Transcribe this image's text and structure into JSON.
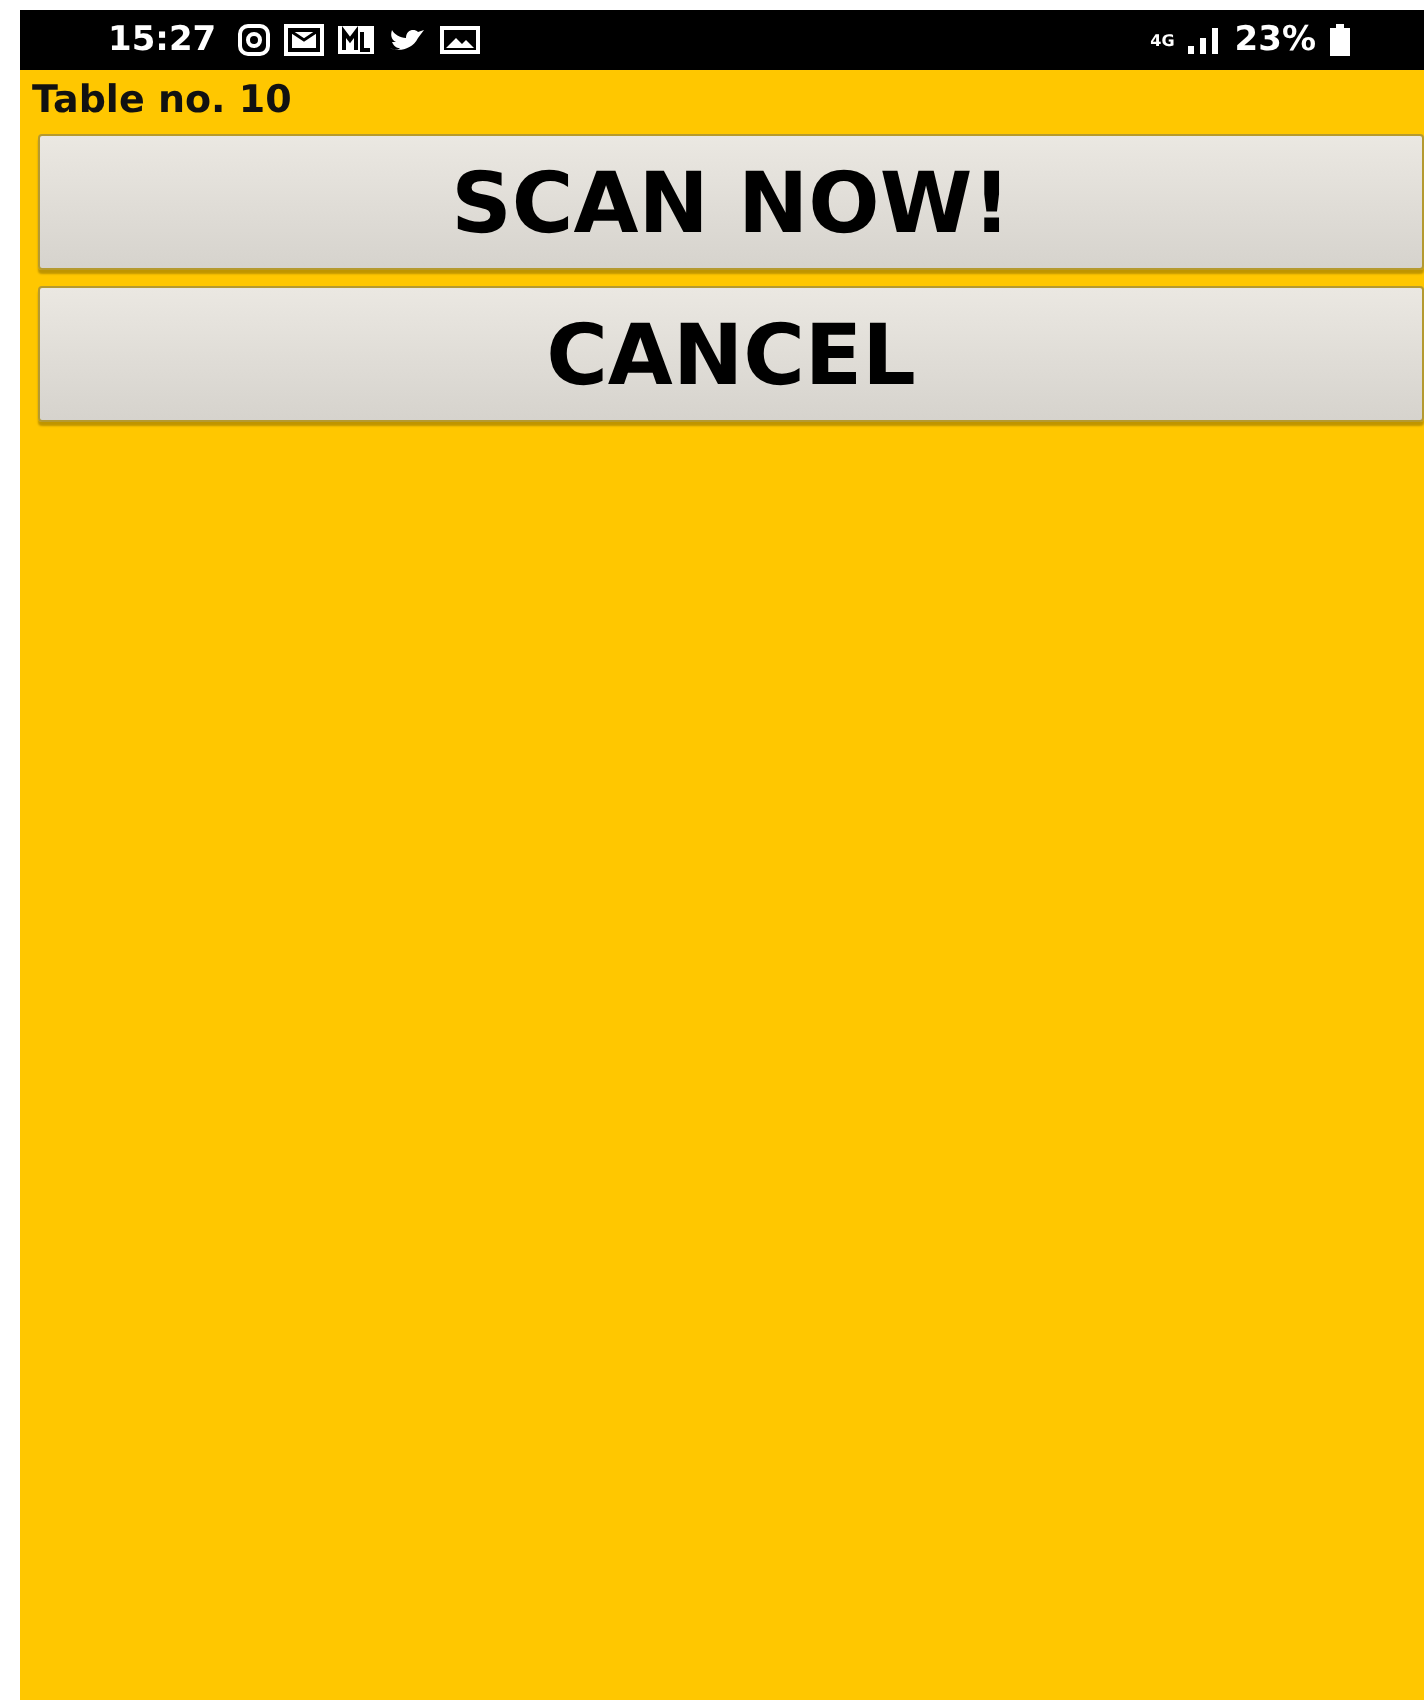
{
  "status_bar": {
    "time": "15:27",
    "network": "4G",
    "battery": "23%"
  },
  "title": "Table no. 10",
  "buttons": [
    {
      "label": "SCAN NOW!"
    },
    {
      "label": "CANCEL"
    }
  ]
}
